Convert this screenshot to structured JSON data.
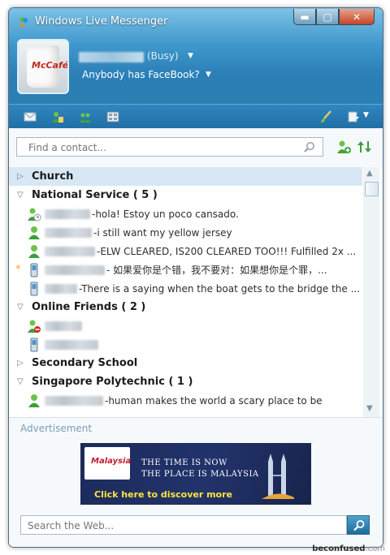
{
  "window": {
    "title": "Windows Live Messenger"
  },
  "titlebar": {
    "minimize": "▬",
    "maximize": "▢",
    "close": "✕"
  },
  "profile": {
    "status": "(Busy)",
    "personal_message": "Anybody has FaceBook?",
    "avatar_text": "McCafé"
  },
  "toolbar": {
    "icons": [
      "mail-icon",
      "contacts-icon",
      "add-group-icon",
      "media-icon",
      "paintbrush-icon",
      "menu-icon"
    ]
  },
  "search": {
    "placeholder": "Find a contact..."
  },
  "contacts": {
    "group_church": "Church",
    "group_national_service": "National Service ( 5 )",
    "ns_msg_1": "-hola! Estoy un poco cansado.",
    "ns_msg_2": "-i still want my yellow jersey",
    "ns_msg_3": "-ELW CLEARED, IS200 CLEARED TOO!!! Fulfilled 2x ...",
    "ns_msg_4": "- 如果爱你是个错，我不要对：如果想你是个罪，...",
    "ns_msg_5": "-There is a saying when the boat gets to the bridge the ...",
    "group_online_friends": "Online Friends ( 2 )",
    "group_secondary_school": "Secondary School",
    "group_singapore_poly": "Singapore Polytechnic ( 1 )",
    "sp_msg_1": "-human makes the world a scary place to be",
    "new_message_marker": "*"
  },
  "ad": {
    "label": "Advertisement",
    "banner_logo": "Malaysia",
    "banner_line1": "THE TIME IS NOW",
    "banner_line2": "THE PLACE IS MALAYSIA",
    "banner_cta": "Click here to discover more"
  },
  "web_search": {
    "placeholder": "Search the Web..."
  },
  "watermark": {
    "brand": "beconfused",
    "suffix": ".com"
  },
  "colors": {
    "header": "#2a7fb6",
    "selected_row": "#d7e8f4",
    "online_green": "#3aa13a",
    "busy_red": "#d62b2b",
    "notify_star": "#f3a33b"
  }
}
